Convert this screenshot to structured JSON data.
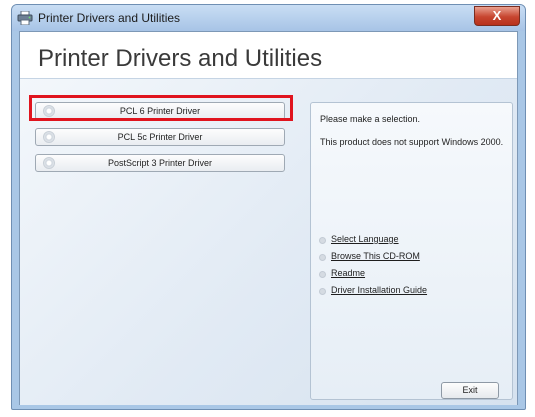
{
  "window": {
    "title": "Printer Drivers and Utilities",
    "close_label": "X",
    "icon": "printer-icon"
  },
  "header": {
    "title": "Printer Drivers and Utilities"
  },
  "drivers": [
    {
      "label": "PCL 6 Printer Driver",
      "icon": "disc-icon",
      "highlighted": true
    },
    {
      "label": "PCL 5c Printer Driver",
      "icon": "disc-icon",
      "highlighted": false
    },
    {
      "label": "PostScript 3 Printer Driver",
      "icon": "disc-icon",
      "highlighted": false
    }
  ],
  "info": {
    "prompt": "Please make a selection.",
    "notice": "This product does not support Windows 2000."
  },
  "links": [
    {
      "label": "Select Language"
    },
    {
      "label": "Browse This CD-ROM"
    },
    {
      "label": "Readme"
    },
    {
      "label": "Driver Installation Guide"
    }
  ],
  "exit_label": "Exit",
  "colors": {
    "highlight": "#e0141e",
    "close_button": "#c7452f",
    "window_frame": "#a9c7e6"
  }
}
